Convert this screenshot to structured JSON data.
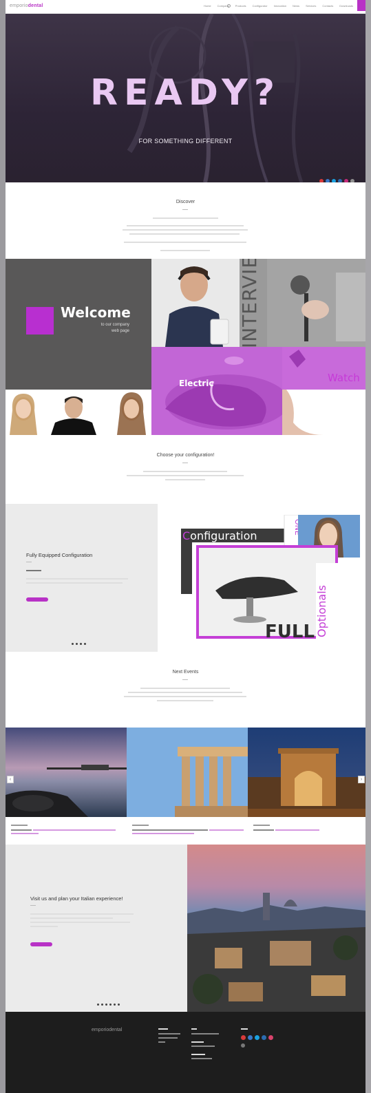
{
  "nav": {
    "logo_a": "emporio",
    "logo_b": "dental",
    "menu": [
      "Home",
      "Company",
      "Products",
      "Configurator",
      "Innovation",
      "News",
      "Services",
      "Contacts",
      "Downloads"
    ]
  },
  "hero": {
    "title": "READY?",
    "subtitle": "FOR SOMETHING DIFFERENT",
    "social": [
      "#d83a3a",
      "#3b79c9",
      "#1aa2e0",
      "#c52a7a",
      "#7a7a7a",
      "#8f8f8f"
    ]
  },
  "discover": {
    "title": "Discover"
  },
  "mosaic": {
    "welcome_title": "Welcome",
    "welcome_sub_1": "to our company",
    "welcome_sub_2": "web page",
    "interview": "INTERVIEW",
    "electric": "Electric",
    "watch": "Watch"
  },
  "choose": {
    "title": "Choose your configuration!"
  },
  "config": {
    "title": "Fully Equipped Configuration",
    "image_word_1": "Configuration",
    "image_word_2": "ONE",
    "image_word_3": "FULL",
    "image_word_4": "Optionals"
  },
  "events": {
    "title": "Next Events"
  },
  "italy": {
    "title": "Visit us and plan your Italian experience!"
  },
  "footer": {
    "logo": "emporiodental"
  },
  "colors": {
    "accent": "#b832c6",
    "hero_bg": "#332a3c",
    "footer_bg": "#1d1d1d"
  }
}
